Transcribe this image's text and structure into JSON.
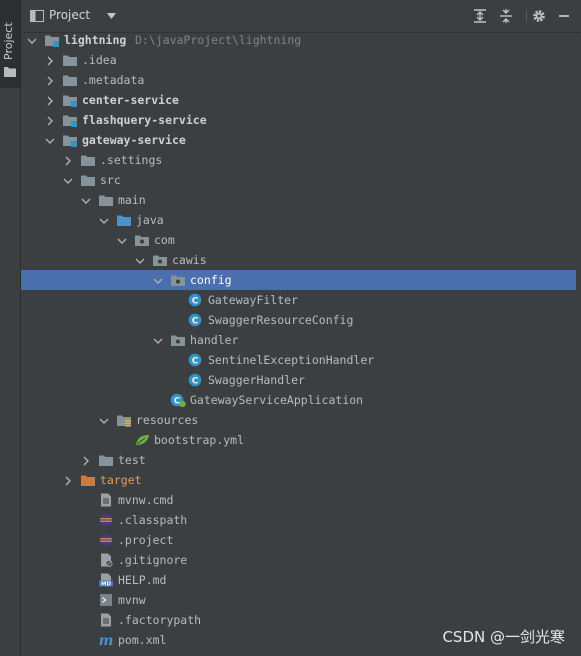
{
  "panel": {
    "side_tab_label": "Project",
    "view_title": "Project",
    "toolbar_icons": [
      "expand-all-icon",
      "collapse-all-icon",
      "gear-icon",
      "hide-icon"
    ]
  },
  "tree": [
    {
      "label": "lightning",
      "path": "D:\\javaProject\\lightning",
      "depth": 0,
      "expanded": true,
      "icon": "module-folder-icon",
      "bold": true
    },
    {
      "label": ".idea",
      "depth": 1,
      "expanded": false,
      "icon": "folder-icon"
    },
    {
      "label": ".metadata",
      "depth": 1,
      "expanded": false,
      "icon": "folder-icon"
    },
    {
      "label": "center-service",
      "depth": 1,
      "expanded": false,
      "icon": "module-folder-icon",
      "bold": true
    },
    {
      "label": "flashquery-service",
      "depth": 1,
      "expanded": false,
      "icon": "module-folder-icon",
      "bold": true
    },
    {
      "label": "gateway-service",
      "depth": 1,
      "expanded": true,
      "icon": "module-folder-icon",
      "bold": true
    },
    {
      "label": ".settings",
      "depth": 2,
      "expanded": false,
      "icon": "folder-icon"
    },
    {
      "label": "src",
      "depth": 2,
      "expanded": true,
      "icon": "folder-icon"
    },
    {
      "label": "main",
      "depth": 3,
      "expanded": true,
      "icon": "folder-icon"
    },
    {
      "label": "java",
      "depth": 4,
      "expanded": true,
      "icon": "source-folder-icon"
    },
    {
      "label": "com",
      "depth": 5,
      "expanded": true,
      "icon": "package-icon"
    },
    {
      "label": "cawis",
      "depth": 6,
      "expanded": true,
      "icon": "package-icon"
    },
    {
      "label": "config",
      "depth": 7,
      "expanded": true,
      "icon": "package-icon",
      "selected": true
    },
    {
      "label": "GatewayFilter",
      "depth": 8,
      "icon": "class-icon"
    },
    {
      "label": "SwaggerResourceConfig",
      "depth": 8,
      "icon": "class-icon"
    },
    {
      "label": "handler",
      "depth": 7,
      "expanded": true,
      "icon": "package-icon"
    },
    {
      "label": "SentinelExceptionHandler",
      "depth": 8,
      "icon": "class-icon"
    },
    {
      "label": "SwaggerHandler",
      "depth": 8,
      "icon": "class-icon"
    },
    {
      "label": "GatewayServiceApplication",
      "depth": 7,
      "icon": "spring-boot-class-icon"
    },
    {
      "label": "resources",
      "depth": 4,
      "expanded": true,
      "icon": "resources-folder-icon"
    },
    {
      "label": "bootstrap.yml",
      "depth": 5,
      "icon": "spring-yml-icon"
    },
    {
      "label": "test",
      "depth": 3,
      "expanded": false,
      "icon": "folder-icon"
    },
    {
      "label": "target",
      "depth": 2,
      "expanded": false,
      "icon": "excluded-folder-icon",
      "target": true
    },
    {
      "label": "mvnw.cmd",
      "depth": 3,
      "icon": "text-file-icon"
    },
    {
      "label": ".classpath",
      "depth": 3,
      "icon": "eclipse-file-icon"
    },
    {
      "label": ".project",
      "depth": 3,
      "icon": "eclipse-file-icon"
    },
    {
      "label": ".gitignore",
      "depth": 3,
      "icon": "ignore-file-icon"
    },
    {
      "label": "HELP.md",
      "depth": 3,
      "icon": "markdown-icon"
    },
    {
      "label": "mvnw",
      "depth": 3,
      "icon": "shell-script-icon"
    },
    {
      "label": ".factorypath",
      "depth": 3,
      "icon": "text-file-icon"
    },
    {
      "label": "pom.xml",
      "depth": 3,
      "icon": "maven-icon"
    }
  ],
  "watermark": "CSDN @一剑光寒",
  "colors": {
    "selection": "#4b6eaf",
    "folder": "#87939a",
    "source_folder": "#4c91c7",
    "module_badge": "#3592c4",
    "class_icon": "#3592c4",
    "excluded_folder": "#d07a3a"
  }
}
